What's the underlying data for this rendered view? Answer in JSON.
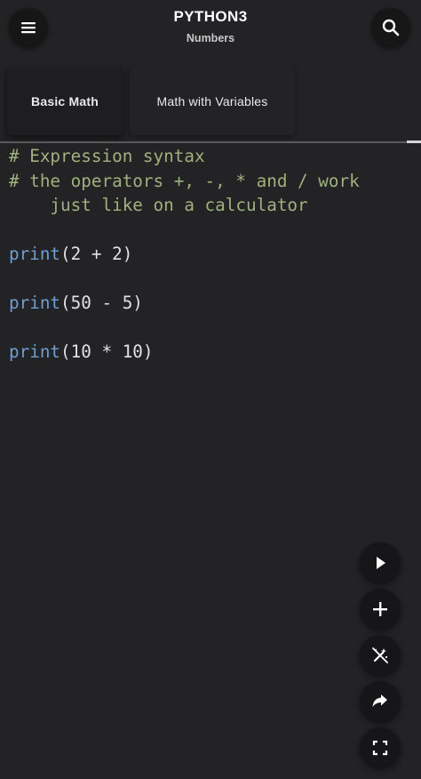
{
  "header": {
    "title": "PYTHON3",
    "subtitle": "Numbers",
    "menu_icon": "menu-icon",
    "search_icon": "search-icon"
  },
  "tabs": [
    {
      "label": "Basic Math",
      "active": true
    },
    {
      "label": "Math with Variables",
      "active": false
    }
  ],
  "code": {
    "comment_1": "# Expression syntax",
    "comment_2": "# the operators +, -, * and / work",
    "comment_3": "    just like on a calculator",
    "line_1_fn": "print",
    "line_1_args": "(2 + 2)",
    "line_2_fn": "print",
    "line_2_args": "(50 - 5)",
    "line_3_fn": "print",
    "line_3_args": "(10 * 10)"
  },
  "actions": [
    {
      "name": "run",
      "icon": "play-icon"
    },
    {
      "name": "add",
      "icon": "plus-icon"
    },
    {
      "name": "magic",
      "icon": "magic-wand-off-icon"
    },
    {
      "name": "share",
      "icon": "share-arrow-icon"
    },
    {
      "name": "fullscreen",
      "icon": "fullscreen-icon"
    }
  ],
  "colors": {
    "background": "#232224",
    "comment": "#9fb17e",
    "function": "#6f9fd0",
    "code_text": "#e2e2e2"
  }
}
